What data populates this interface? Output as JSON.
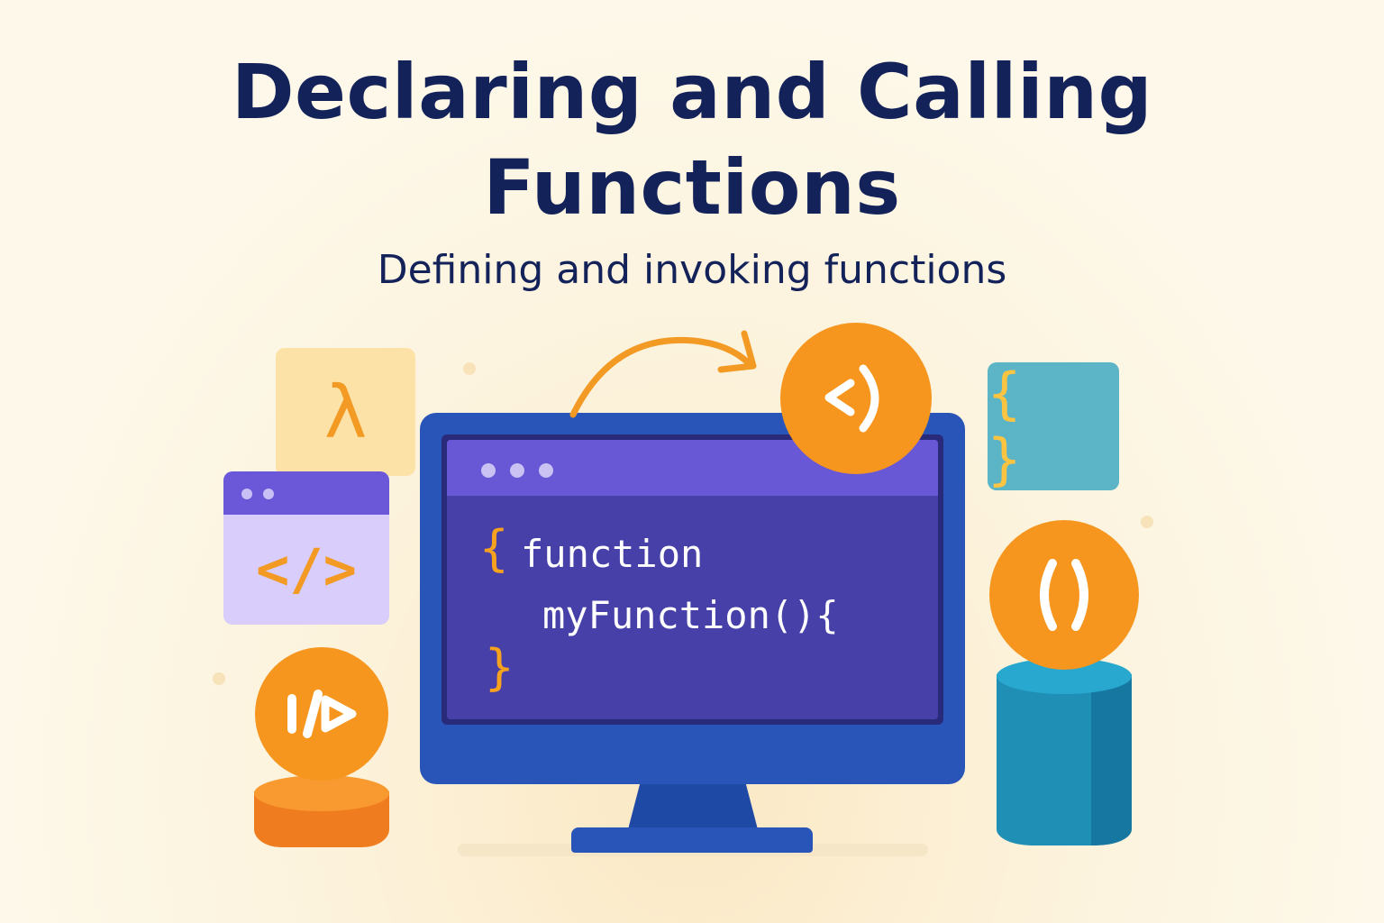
{
  "title": {
    "line1": "Declaring and Calling",
    "line2": "Functions"
  },
  "subtitle": "Defining and invoking functions",
  "code": {
    "open_brace": "{",
    "keyword": "function",
    "call": "myFunction(){",
    "close_brace": "}"
  },
  "tiles": {
    "lambda": "λ",
    "html_tag": "</>",
    "braces": "{ }"
  },
  "colors": {
    "title": "#14225a",
    "accent_orange": "#f6961f",
    "monitor_blue": "#2a55b8",
    "screen_purple": "#4640a8",
    "teal": "#5cb4c7"
  },
  "icons": {
    "arrow": "curved-arrow-icon",
    "code_bracket_circle": "code-bracket-circle-icon",
    "parentheses_circle": "parentheses-circle-icon",
    "play_circle": "code-play-circle-icon"
  }
}
